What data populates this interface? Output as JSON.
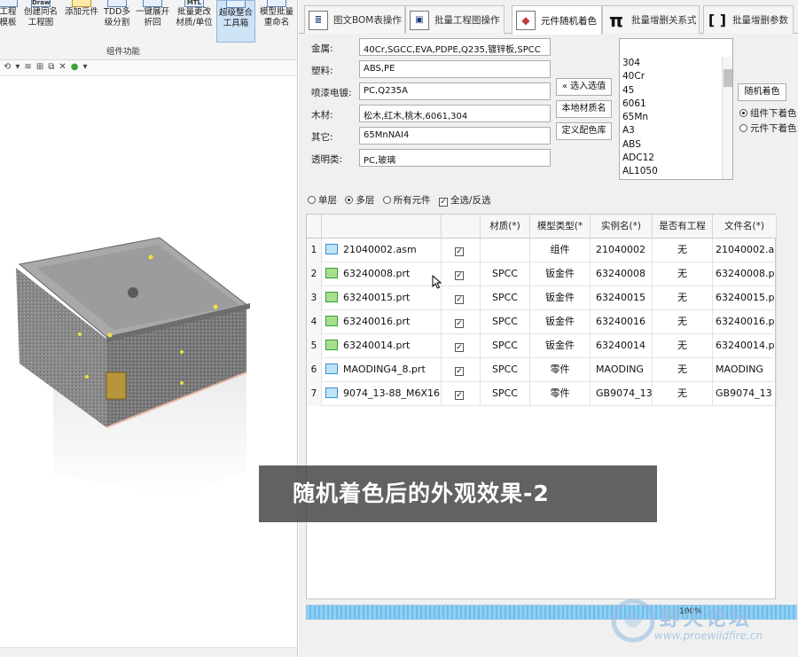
{
  "ribbon": {
    "buttons": [
      {
        "label1": "工程",
        "label2": "模板"
      },
      {
        "label1": "创建同名",
        "label2": "工程图"
      },
      {
        "label1": "添加元件",
        "label2": ""
      },
      {
        "label1": "TDD多",
        "label2": "级分割"
      },
      {
        "label1": "一键展开",
        "label2": "折回"
      },
      {
        "label1": "批量更改",
        "label2": "材质/单位"
      },
      {
        "label1": "超级整合",
        "label2": "工具箱"
      },
      {
        "label1": "模型批量",
        "label2": "重命名"
      }
    ],
    "group_label": "组件功能",
    "icon_text_draw": "Draw",
    "icon_text_mtl": "MTL"
  },
  "tabs": [
    {
      "label": "图文BOM表操作",
      "icon": "list-icon"
    },
    {
      "label": "批量工程图操作",
      "icon": "drawing-icon"
    },
    {
      "label": "元件随机着色",
      "icon": "palette-icon"
    },
    {
      "label": "批量增删关系式",
      "icon": "pi-icon",
      "glyph": "π"
    },
    {
      "label": "批量增删参数",
      "icon": "brackets-icon",
      "glyph": "[ ]"
    }
  ],
  "materials": [
    {
      "label": "金属:",
      "value": "40Cr,SGCC,EVA,PDPE,Q235,镀锌板,SPCC"
    },
    {
      "label": "塑料:",
      "value": "ABS,PE"
    },
    {
      "label": "喷漆电镀:",
      "value": "PC,Q235A"
    },
    {
      "label": "木材:",
      "value": "松木,红木,桃木,6061,304"
    },
    {
      "label": "其它:",
      "value": "65MnNAI4"
    },
    {
      "label": "透明类:",
      "value": "PC,玻璃"
    }
  ],
  "buttons": {
    "select": "« 选入选值",
    "local_lib": "本地材质名",
    "define_color": "定义配色库",
    "random_color": "随机着色"
  },
  "material_list": [
    "304",
    "40Cr",
    "45",
    "6061",
    "65Mn",
    "A3",
    "ABS",
    "ADC12",
    "AL1050"
  ],
  "color_mode": {
    "component": "组件下着色",
    "part": "元件下着色",
    "selected": "component"
  },
  "layer_opts": {
    "single": "单层",
    "multi": "多层",
    "all": "所有元件",
    "select_all": "全选/反选"
  },
  "grid": {
    "headers": [
      "材质(*)",
      "模型类型(*",
      "实例名(*)",
      "是否有工程",
      "文件名(*)"
    ],
    "rows": [
      {
        "n": "1",
        "name": "21040002.asm",
        "checked": true,
        "mat": "",
        "type": "组件",
        "inst": "21040002",
        "dwg": "无",
        "file": "21040002.a",
        "icon": "asm"
      },
      {
        "n": "2",
        "name": "63240008.prt",
        "checked": true,
        "mat": "SPCC",
        "type": "钣金件",
        "inst": "63240008",
        "dwg": "无",
        "file": "63240008.p",
        "icon": "sheet"
      },
      {
        "n": "3",
        "name": "63240015.prt",
        "checked": true,
        "mat": "SPCC",
        "type": "钣金件",
        "inst": "63240015",
        "dwg": "无",
        "file": "63240015.p",
        "icon": "sheet"
      },
      {
        "n": "4",
        "name": "63240016.prt",
        "checked": true,
        "mat": "SPCC",
        "type": "钣金件",
        "inst": "63240016",
        "dwg": "无",
        "file": "63240016.p",
        "icon": "sheet"
      },
      {
        "n": "5",
        "name": "63240014.prt",
        "checked": true,
        "mat": "SPCC",
        "type": "钣金件",
        "inst": "63240014",
        "dwg": "无",
        "file": "63240014.p",
        "icon": "sheet"
      },
      {
        "n": "6",
        "name": "MAODING4_8.prt",
        "checked": true,
        "mat": "SPCC",
        "type": "零件",
        "inst": "MAODING",
        "dwg": "无",
        "file": "MAODING",
        "icon": "part"
      },
      {
        "n": "7",
        "name": "9074_13-88_M6X16",
        "checked": true,
        "mat": "SPCC",
        "type": "零件",
        "inst": "GB9074_13",
        "dwg": "无",
        "file": "GB9074_13",
        "icon": "part"
      }
    ]
  },
  "progress": {
    "value": 100,
    "text": "100%"
  },
  "caption": "随机着色后的外观效果-2",
  "watermark": {
    "title": "野火论坛",
    "url": "www.proewildfire.cn"
  },
  "colors": {
    "accent": "#cfe3f7",
    "progress": "#7cc6ef"
  }
}
